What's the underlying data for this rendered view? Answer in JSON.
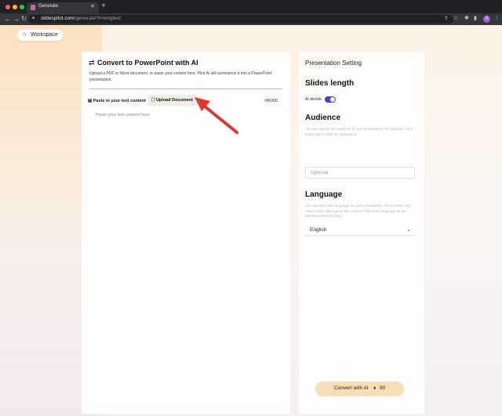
{
  "browser": {
    "tab_title": "Generate",
    "url_host": "slidespilot.com",
    "url_path": "/generate?t=longtext",
    "profile_initial": "S"
  },
  "page": {
    "workspace_label": "Workspace",
    "left": {
      "title": "Convert to PowerPoint with AI",
      "description": "Upload a PDF or Word document, or paste your content here. Pilot AI will summarize it into a PowerPoint presentation.",
      "tab_paste": "Paste in your text content",
      "tab_upload": "Upload Document",
      "char_counter": "/45000",
      "text_placeholder": "Paste your text content here"
    },
    "right": {
      "setting_title": "Presentation Setting",
      "slides_length_heading": "Slides length",
      "ai_decide_label": "AI decide",
      "ai_decide_on": true,
      "audience_heading": "Audience",
      "audience_hint": "You can specify the audience of your presentation. It's optional, but it might help AI with the generation.",
      "audience_placeholder": "Optional",
      "language_heading": "Language",
      "language_hint": "You can select the language for your presentation. Pilot Create may make it that slides generate content in the same language as the text/document provided.",
      "language_value": "English"
    },
    "convert_button": {
      "label": "Convert with AI",
      "credits": "90"
    }
  },
  "colors": {
    "toggle_on": "#4a3fd1",
    "convert_button": "#f8deb6",
    "annotation_arrow": "#e2362f"
  }
}
